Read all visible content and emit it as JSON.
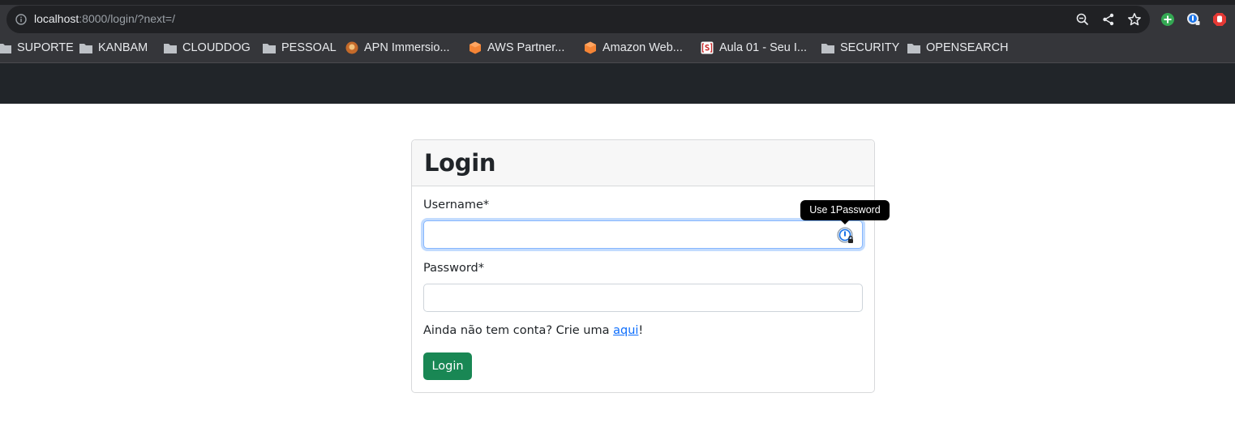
{
  "browser": {
    "url_host": "localhost",
    "url_rest": ":8000/login/?next=/",
    "bookmarks": [
      {
        "label": "SUPORTE",
        "icon": "folder-icon"
      },
      {
        "label": "KANBAM",
        "icon": "folder-icon"
      },
      {
        "label": "CLOUDDOG",
        "icon": "folder-icon"
      },
      {
        "label": "PESSOAL",
        "icon": "folder-icon"
      },
      {
        "label": "APN Immersio...",
        "icon": "apn-favicon"
      },
      {
        "label": "AWS Partner...",
        "icon": "aws-cube-icon"
      },
      {
        "label": "Amazon Web...",
        "icon": "aws-cube-icon"
      },
      {
        "label": "Aula 01 - Seu I...",
        "icon": "s-bracket-favicon"
      },
      {
        "label": "SECURITY",
        "icon": "folder-icon"
      },
      {
        "label": "OPENSEARCH",
        "icon": "folder-icon"
      }
    ]
  },
  "login": {
    "title": "Login",
    "username_label": "Username*",
    "username_value": "",
    "password_label": "Password*",
    "password_value": "",
    "helper_text": "Ainda não tem conta? Crie uma ",
    "helper_link": "aqui",
    "helper_suffix": "!",
    "submit_label": "Login"
  },
  "tooltip": {
    "text": "Use 1Password"
  },
  "colors": {
    "navbar": "#212529",
    "button": "#198754",
    "link": "#0d6efd",
    "focus": "#86b7fe"
  }
}
